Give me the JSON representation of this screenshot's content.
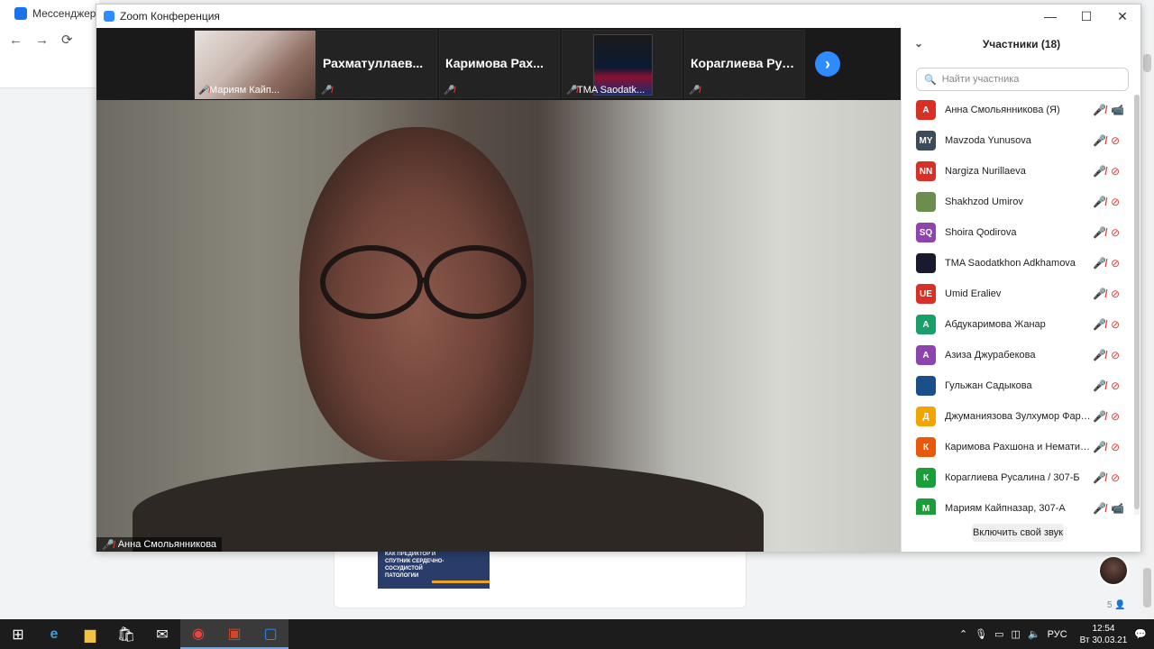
{
  "browser": {
    "tab_title": "Мессенджер",
    "nav": {
      "back": "←",
      "forward": "→",
      "reload": "⟳"
    },
    "sidebar_count": "5"
  },
  "zoom": {
    "window_title": "Zoom Конференция",
    "window_buttons": {
      "minimize": "—",
      "maximize": "☐",
      "close": "✕"
    },
    "thumbnails": [
      {
        "name": "",
        "label": "Мариям Кайп...",
        "has_video": true
      },
      {
        "name": "Рахматуллаев...",
        "label": "",
        "has_video": false
      },
      {
        "name": "Каримова Рах...",
        "label": "",
        "has_video": false
      },
      {
        "name": "",
        "label": "TMA Saodatk...",
        "has_video": true
      },
      {
        "name": "Кораглиева Рус...",
        "label": "",
        "has_video": false
      }
    ],
    "next_arrow": "›",
    "main_speaker_label": "Анна Смольянникова",
    "participants_panel": {
      "title": "Участники (18)",
      "collapse_icon": "⌄",
      "search_placeholder": "Найти участника",
      "participants": [
        {
          "initials": "A",
          "name": "Анна Смольянникова (Я)",
          "color": "#d93025",
          "camera_on": true
        },
        {
          "initials": "MY",
          "name": "Mavzoda Yunusova",
          "color": "#3c4a5a",
          "camera_on": false
        },
        {
          "initials": "NN",
          "name": "Nargiza Nurillaeva",
          "color": "#d93025",
          "camera_on": false
        },
        {
          "initials": "",
          "name": "Shakhzod Umirov",
          "color": "#6b8e4e",
          "camera_on": false
        },
        {
          "initials": "SQ",
          "name": "Shoira Qodirova",
          "color": "#8e44ad",
          "camera_on": false
        },
        {
          "initials": "",
          "name": "TMA Saodatkhon Adkhamova",
          "color": "#1a1a2e",
          "camera_on": false
        },
        {
          "initials": "UE",
          "name": "Umid Eraliev",
          "color": "#d93025",
          "camera_on": false
        },
        {
          "initials": "A",
          "name": "Абдукаримова Жанар",
          "color": "#1a9e6a",
          "camera_on": false
        },
        {
          "initials": "A",
          "name": "Азиза Джурабекова",
          "color": "#8e44ad",
          "camera_on": false
        },
        {
          "initials": "",
          "name": "Гульжан Садыкова",
          "color": "#1b4f8a",
          "camera_on": false
        },
        {
          "initials": "Д",
          "name": "Джуманиязова Зулхумор Фарха...",
          "color": "#f0a500",
          "camera_on": false
        },
        {
          "initials": "К",
          "name": "Каримова Рахшона и Нематилла...",
          "color": "#e8590c",
          "camera_on": false
        },
        {
          "initials": "К",
          "name": "Кораглиева Русалина / 307-Б",
          "color": "#1a9e3a",
          "camera_on": false
        },
        {
          "initials": "М",
          "name": "Мариям Кайпназар, 307-А",
          "color": "#1a9e3a",
          "camera_on": true
        }
      ],
      "unmute_button": "Включить свой звук"
    }
  },
  "post": {
    "thumb_text": "КАК ПРЕДИКТОР И СПУТНИК СЕРДЕЧНО-СОСУДИСТОЙ ПАТОЛОГИИ"
  },
  "taskbar": {
    "language": "РУС",
    "time": "12:54",
    "date": "Вт 30.03.21"
  }
}
